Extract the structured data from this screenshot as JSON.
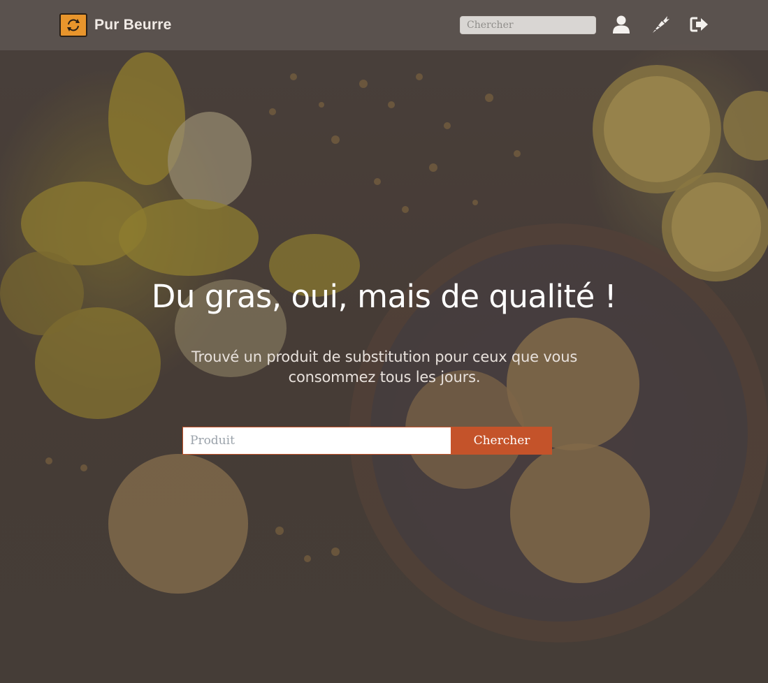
{
  "navbar": {
    "brand_name": "Pur Beurre",
    "search_placeholder": "Chercher",
    "icons": [
      "user-icon",
      "carrot-icon",
      "sign-out-icon"
    ]
  },
  "hero": {
    "title": "Du gras, oui, mais de qualité !",
    "subtitle": "Trouvé un produit de substitution pour ceux que vous consommez tous les jours.",
    "product_placeholder": "Produit",
    "search_button_label": "Chercher"
  },
  "colors": {
    "accent": "#c4532a",
    "logo": "#e8952c",
    "navbar": "#5c5450",
    "background": "#4b3f39"
  }
}
